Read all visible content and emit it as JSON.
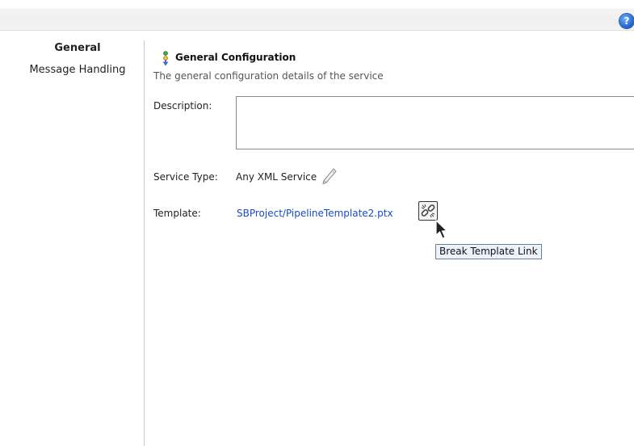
{
  "toolbar": {
    "help_icon": "help-icon",
    "help_glyph": "?"
  },
  "sidebar": {
    "items": [
      {
        "label": "General",
        "active": true
      },
      {
        "label": "Message Handling",
        "active": false
      }
    ]
  },
  "section": {
    "title": "General Configuration",
    "subtitle": "The general configuration details of the service",
    "icon": "configuration-icon"
  },
  "form": {
    "description": {
      "label": "Description:",
      "value": ""
    },
    "service_type": {
      "label": "Service Type:",
      "value": "Any XML Service",
      "edit_icon": "pencil-icon"
    },
    "template": {
      "label": "Template:",
      "link": "SBProject/PipelineTemplate2.ptx",
      "break_button_icon": "break-link-icon",
      "tooltip": "Break Template Link"
    }
  },
  "colors": {
    "link": "#1a4cc7",
    "tooltip_bg": "#eef3fb"
  }
}
